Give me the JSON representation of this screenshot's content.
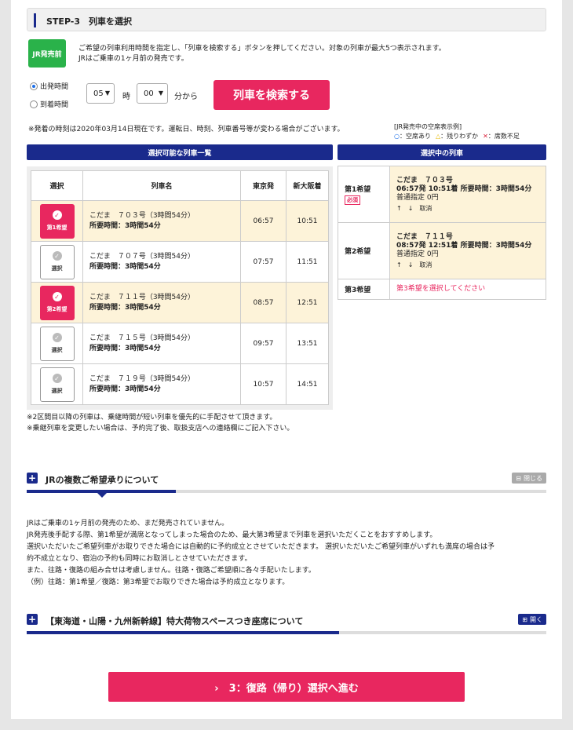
{
  "step": {
    "title": "STEP-3　列車を選択"
  },
  "badge": "JR発売前",
  "intro": [
    "ご希望の列車利用時間を指定し、「列車を検索する」ボタンを押してください。対象の列車が最大5つ表示されます。",
    "JRはご乗車の1ヶ月前の発売です。"
  ],
  "radios": {
    "depart": "出発時間",
    "arrive": "到着時間"
  },
  "time": {
    "hour": "05",
    "hour_unit": "時",
    "minute": "00",
    "minute_unit": "分から"
  },
  "search_btn": "列車を検索する",
  "note_time": "※発着の時刻は2020年03月14日現在です。運転日、時刻、列車番号等が変わる場合がございます。",
  "legend": {
    "title": "[JR発売中の空席表示例]",
    "items": [
      "○：空席あり",
      "△：残りわずか",
      "✕：席数不足"
    ],
    "colors": [
      "#1b6ee8",
      "#e6b800",
      "#d9213a"
    ]
  },
  "list": {
    "header": "選択可能な列車一覧",
    "cols": [
      "選択",
      "列車名",
      "東京発",
      "新大阪着"
    ],
    "rows": [
      {
        "pick": "第1希望",
        "name": "こだま　７０３号（3時間54分）",
        "dur": "所要時間：3時間54分",
        "dep": "06:57",
        "arr": "10:51"
      },
      {
        "pick": "選択",
        "name": "こだま　７０７号（3時間54分）",
        "dur": "所要時間：3時間54分",
        "dep": "07:57",
        "arr": "11:51"
      },
      {
        "pick": "第2希望",
        "name": "こだま　７１１号（3時間54分）",
        "dur": "所要時間：3時間54分",
        "dep": "08:57",
        "arr": "12:51"
      },
      {
        "pick": "選択",
        "name": "こだま　７１５号（3時間54分）",
        "dur": "所要時間：3時間54分",
        "dep": "09:57",
        "arr": "13:51"
      },
      {
        "pick": "選択",
        "name": "こだま　７１９号（3時間54分）",
        "dur": "所要時間：3時間54分",
        "dep": "10:57",
        "arr": "14:51"
      }
    ]
  },
  "selected": {
    "header": "選択中の列車",
    "rows": [
      {
        "k": "第1希望",
        "must": "必須",
        "l1": "こだま　７０３号",
        "l2": "06:57発 10:51着 所要時間：3時間54分",
        "seat": "普通指定 0円",
        "up": "↑",
        "down": "↓",
        "cancel": "取消"
      },
      {
        "k": "第2希望",
        "l1": "こだま　７１１号",
        "l2": "08:57発 12:51着 所要時間：3時間54分",
        "seat": "普通指定 0円",
        "up": "↑",
        "down": "↓",
        "cancel": "取消"
      },
      {
        "k": "第3希望",
        "msg": "第3希望を選択してください"
      }
    ]
  },
  "foot_notes": [
    "※2区間目以降の列車は、乗継時間が短い列車を優先的に手配させて頂きます。",
    "※乗継列車を変更したい場合は、予約完了後、取扱支店への連絡欄にご記入下さい。"
  ],
  "acc1": {
    "title": "JRの複数ご希望承りについて",
    "toggle": "閉じる"
  },
  "acc1_body": [
    "JRはご乗車の1ヶ月前の発売のため、まだ発売されていません。",
    "JR発売後手配する際、第1希望が満席となってしまった場合のため、最大第3希望まで列車を選択いただくことをおすすめします。",
    "選択いただいたご希望列車がお取りできた場合には自動的に予約成立とさせていただきます。 選択いただいたご希望列車がいずれも満席の場合は予",
    "約不成立となり、宿泊の予約も同時にお取消しとさせていただきます。",
    "また、往路・復路の組み合せは考慮しません。往路・復路ご希望順に各々手配いたします。",
    "（例）往路：第1希望／復路：第3希望でお取りできた場合は予約成立となります。"
  ],
  "acc2": {
    "title": "【東海道・山陽・九州新幹線】特大荷物スペースつき座席について",
    "toggle": "開く"
  },
  "next_btn": "›　3：復路（帰り）選択へ進む"
}
